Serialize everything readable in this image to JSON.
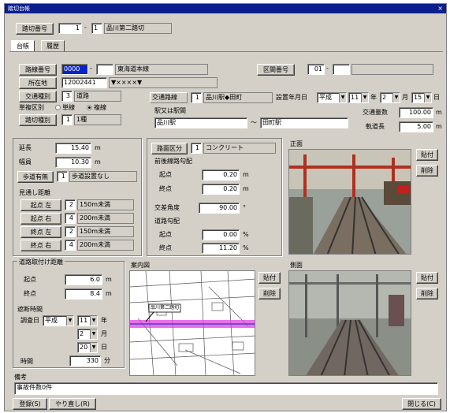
{
  "window": {
    "title": "踏切台帳",
    "close_glyph": "×"
  },
  "header": {
    "crossing_no_label": "踏切番号",
    "crossing_no": "1",
    "crossing_sub": "1",
    "crossing_name": "品川第二踏切"
  },
  "tabs": [
    "台帳",
    "履歴"
  ],
  "basic": {
    "route_no_label": "路線番号",
    "route_no": "0000",
    "route_name": "東海道本線",
    "office_label": "所在地",
    "office_code": "12002441",
    "office_name": "▼××××▼",
    "type_label": "交通種別",
    "type_code": "3",
    "type_value": "道路",
    "single_double_label": "単複区別",
    "single": "単線",
    "double": "複線",
    "class_label": "踏切種別",
    "class_code": "1",
    "class_value": "1種",
    "link_btn": "区間番号",
    "link_val": "01",
    "carry_label": "交通路線",
    "carry_code": "1",
    "carry_value": "品川駅◆田町",
    "date_label": "設置年月日",
    "era": "平成",
    "year": "11",
    "year_unit": "年",
    "month": "2",
    "month_unit": "月",
    "day": "15",
    "day_unit": "日",
    "between_label": "駅又は駅間",
    "from_station": "品川駅",
    "tilde": "～",
    "to_station": "田町駅",
    "traffic_label": "交通量数",
    "traffic_value": "100.00",
    "traffic_unit": "m",
    "rail_len_label": "軌道長",
    "rail_len": "5.00",
    "rail_len_unit": "m"
  },
  "dims": {
    "length_label": "延長",
    "length": "15.40",
    "length_unit": "m",
    "width_label": "幅員",
    "width": "10.30",
    "width_unit": "m",
    "sidewalk_btn": "歩道有無",
    "sidewalk_code": "1",
    "sidewalk_value": "歩道設置なし",
    "paving_btn": "路面区分",
    "paving_code": "1",
    "paving_value": "コンクリート",
    "gradient_title": "前後線路勾配",
    "start_label": "起点",
    "start_val": "0.20",
    "start_unit": "m",
    "end_label": "終点",
    "end_val": "0.20",
    "end_unit": "m",
    "angle_label": "交差角度",
    "angle_val": "90.00",
    "angle_unit": "°",
    "road_grad_title": "道路勾配",
    "rg_start_label": "起点",
    "rg_start": "0.00",
    "rg_start_unit": "%",
    "rg_end_label": "終点",
    "rg_end": "11.20",
    "rg_end_unit": "%"
  },
  "visibility": {
    "title": "見通し距離",
    "rows": [
      {
        "btn": "起点 左",
        "code": "2",
        "value": "150m未満"
      },
      {
        "btn": "起点 右",
        "code": "4",
        "value": "200m未満"
      },
      {
        "btn": "終点 左",
        "code": "2",
        "value": "150m未満"
      },
      {
        "btn": "終点 右",
        "code": "4",
        "value": "200m未満"
      }
    ]
  },
  "approach": {
    "title": "道路取付け距離",
    "start_label": "起点",
    "start": "6.0",
    "start_unit": "m",
    "end_label": "終点",
    "end": "8.4",
    "end_unit": "m"
  },
  "closure": {
    "title": "遮断時間",
    "survey_label": "調査日",
    "era": "平成",
    "year": "11",
    "year_unit": "年",
    "month": "2",
    "month_unit": "月",
    "day": "20",
    "day_unit": "日",
    "time_label": "時間",
    "time_value": "330",
    "time_unit": "分"
  },
  "photos": {
    "front_title": "正面",
    "map_title": "案内図",
    "side_title": "側面",
    "paste": "貼付",
    "delete": "削除",
    "map_label": "品川第二踏切"
  },
  "remarks": {
    "label": "備考",
    "value": "事故件数0件"
  },
  "footer": {
    "register": "登録(S)",
    "undo": "やり直し(R)",
    "close": "閉じる(C)"
  },
  "colors": {
    "titlebar": "#0a1e8c",
    "face": "#d4d0c8",
    "highlight": "#0a24c8",
    "map_route": "#e040e0"
  }
}
